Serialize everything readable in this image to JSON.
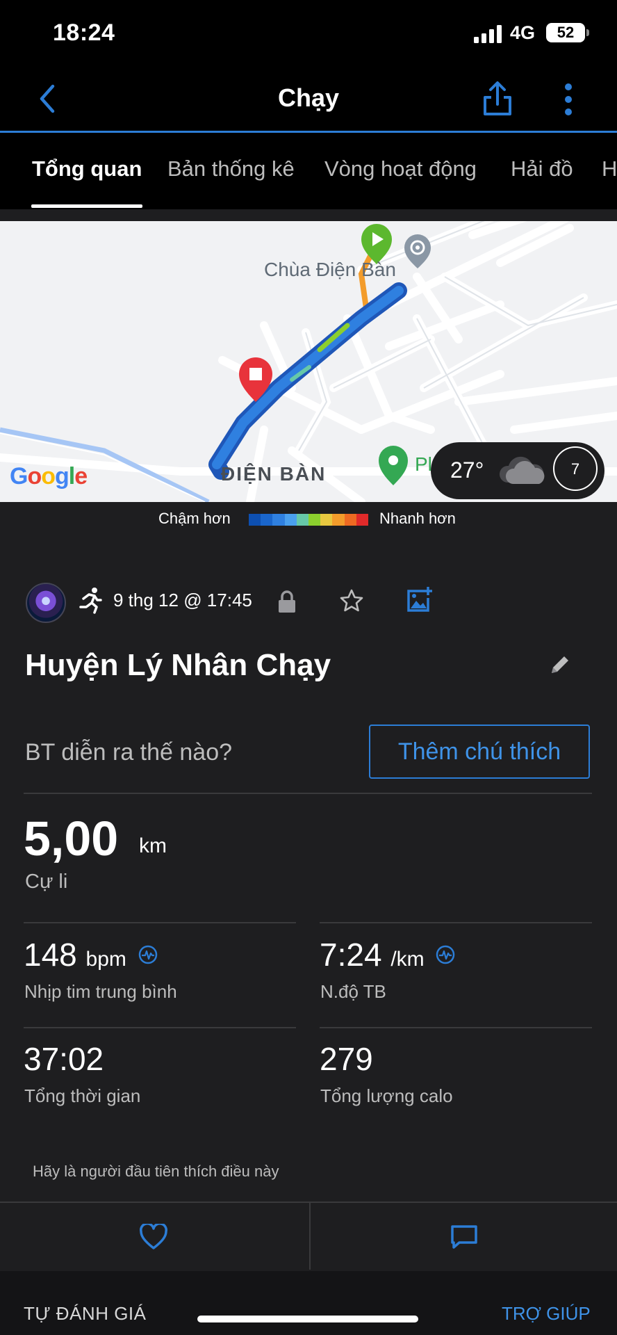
{
  "status_bar": {
    "time": "18:24",
    "network": "4G",
    "battery": "52"
  },
  "header": {
    "title": "Chạy"
  },
  "tabs": [
    {
      "label": "Tổng quan",
      "active": true
    },
    {
      "label": "Bản thống kê",
      "active": false
    },
    {
      "label": "Vòng hoạt động",
      "active": false
    },
    {
      "label": "Hải đồ",
      "active": false
    }
  ],
  "map": {
    "poi_temple": "Chùa Điện Bàn",
    "area_label": "ĐIỆN BÀN",
    "poi_partial": "Pl",
    "google_logo": "Google",
    "weather_temp": "27°",
    "wind_value": "7"
  },
  "legend": {
    "slow_label": "Chậm hơn",
    "fast_label": "Nhanh hơn",
    "colors": [
      "#0d4fb0",
      "#1a66cc",
      "#2f80e0",
      "#4aa0ee",
      "#66c8a8",
      "#8ccf2e",
      "#e8c840",
      "#f39c2b",
      "#ee6a22",
      "#e02a2a"
    ]
  },
  "activity": {
    "date_time": "9 thg 12 @ 17:45",
    "name": "Huyện Lý Nhân Chạy",
    "prompt": "BT diễn ra thế nào?",
    "add_note_label": "Thêm chú thích"
  },
  "stats": {
    "distance": {
      "value": "5,00",
      "unit": "km",
      "label": "Cự li"
    },
    "heart_rate": {
      "value": "148",
      "unit": "bpm",
      "label": "Nhịp tim trung bình"
    },
    "pace": {
      "value": "7:24",
      "unit": "/km",
      "label": "N.độ TB"
    },
    "total_time": {
      "value": "37:02",
      "label": "Tổng thời gian"
    },
    "calories": {
      "value": "279",
      "label": "Tổng lượng calo"
    }
  },
  "social": {
    "likes_text": "Hãy là người đầu tiên thích điều này"
  },
  "footer": {
    "self_eval_label": "TỰ ĐÁNH GIÁ",
    "help_label": "TRỢ GIÚP"
  },
  "colors": {
    "accent": "#2c7dd6",
    "background": "#1e1e20",
    "start_marker": "#5cb82e",
    "end_marker": "#e8333b"
  }
}
